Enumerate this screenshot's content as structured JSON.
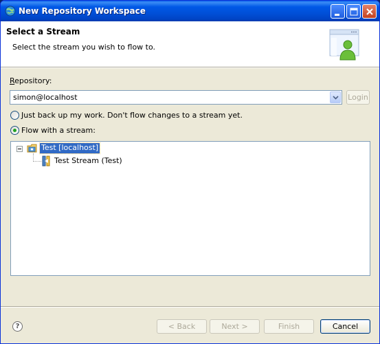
{
  "window": {
    "title": "New Repository Workspace",
    "controls": [
      "minimize-icon",
      "maximize-icon",
      "close-icon"
    ]
  },
  "header": {
    "title": "Select a Stream",
    "description": "Select the stream you wish to flow to."
  },
  "form": {
    "repository_label": "Repository:",
    "repository_value": "simon@localhost",
    "login_label": "Login",
    "option_backup_label": "Just back up my work. Don't flow changes to a stream yet.",
    "option_flow_label": "Flow with a stream:",
    "selected_option": "flow"
  },
  "tree": {
    "items": [
      {
        "label": "Test [localhost]",
        "icon": "repository-icon",
        "selected": true,
        "expanded": true
      },
      {
        "label": "Test Stream (Test)",
        "icon": "stream-icon",
        "selected": false
      }
    ]
  },
  "buttons": {
    "back": "< Back",
    "next": "Next >",
    "finish": "Finish",
    "cancel": "Cancel",
    "help": "?"
  },
  "colors": {
    "titlebar": "#0054e3",
    "selection": "#316ac5",
    "dialog_bg": "#ece9d8"
  }
}
